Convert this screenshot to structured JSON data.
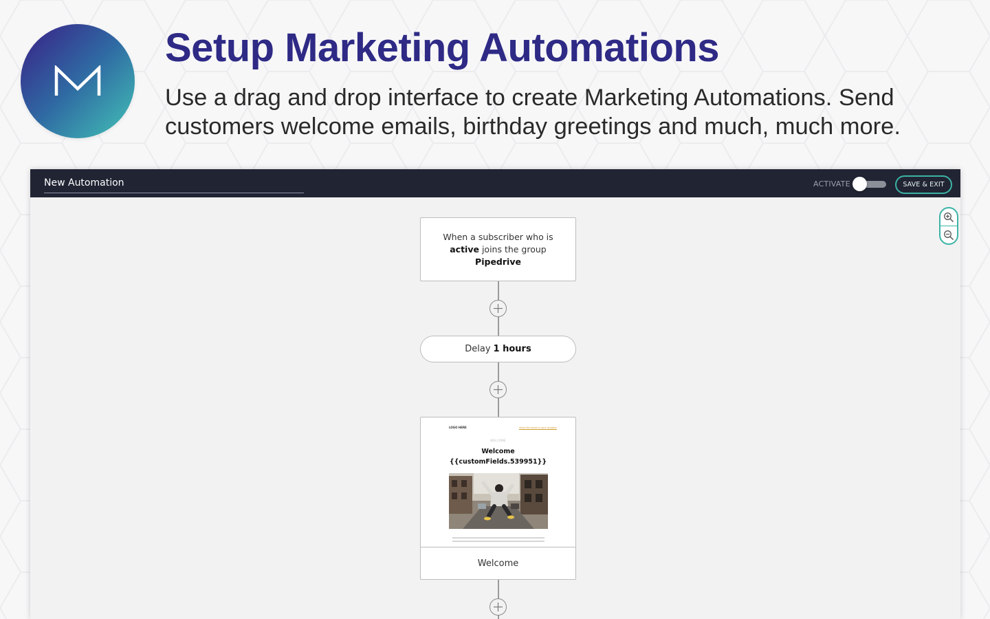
{
  "hero": {
    "title": "Setup Marketing Automations",
    "description": "Use a drag and drop interface to create Marketing Automations. Send customers welcome emails, birthday greetings and much, much more.",
    "logo_letter": "M"
  },
  "toolbar": {
    "automation_name": "New Automation",
    "activate_label": "ACTIVATE",
    "activate_on": false,
    "save_label": "SAVE & EXIT"
  },
  "zoom": {
    "in_icon": "zoom-in-icon",
    "out_icon": "zoom-out-icon"
  },
  "flow": {
    "trigger": {
      "prefix": "When a subscriber who is",
      "status": "active",
      "middle": " joins the group",
      "group": "Pipedrive"
    },
    "delay": {
      "prefix": "Delay",
      "value": "1 hours"
    },
    "email": {
      "title": "Welcome",
      "preview": {
        "logo": "LOGO HERE",
        "link": "View this email in your browser",
        "kicker": "WELCOME",
        "heading": "Welcome",
        "merge_field": "{{customFields.539951}}",
        "image": "person-jumping-street-photo"
      }
    },
    "add_icon": "plus-circle-icon"
  },
  "colors": {
    "title": "#2e2a85",
    "topbar": "#212433",
    "accent": "#3cb4a6",
    "canvas": "#f2f2f2"
  }
}
